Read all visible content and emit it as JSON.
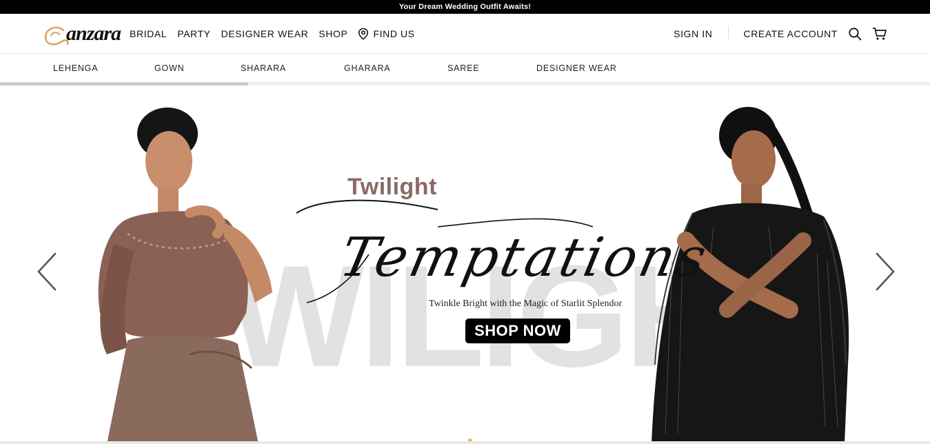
{
  "announcement": "Your Dream Wedding Outfit Awaits!",
  "brand": {
    "name": "anzara",
    "accent": "#d9a050"
  },
  "main_nav": [
    {
      "label": "BRIDAL"
    },
    {
      "label": "PARTY"
    },
    {
      "label": "DESIGNER WEAR"
    },
    {
      "label": "SHOP"
    },
    {
      "label": "FIND US",
      "icon": "location-pin-icon"
    }
  ],
  "account": {
    "sign_in": "SIGN IN",
    "create_account": "CREATE ACCOUNT",
    "search_icon": "search-icon",
    "cart_icon": "cart-icon"
  },
  "categories": [
    "LEHENGA",
    "GOWN",
    "SHARARA",
    "GHARARA",
    "SAREE",
    "DESIGNER WEAR"
  ],
  "hero": {
    "headline_top": "Twilight",
    "headline_script": "Temptations",
    "background_word": "WILIGH",
    "tagline": "Twinkle Bright with the Magic of Starlit Splendor",
    "cta": "SHOP NOW",
    "prev_icon": "chevron-left-icon",
    "next_icon": "chevron-right-icon",
    "colors": {
      "headline_top": "#8a6a66",
      "cta_bg": "#000000",
      "dot_active": "#f0b35a"
    }
  }
}
